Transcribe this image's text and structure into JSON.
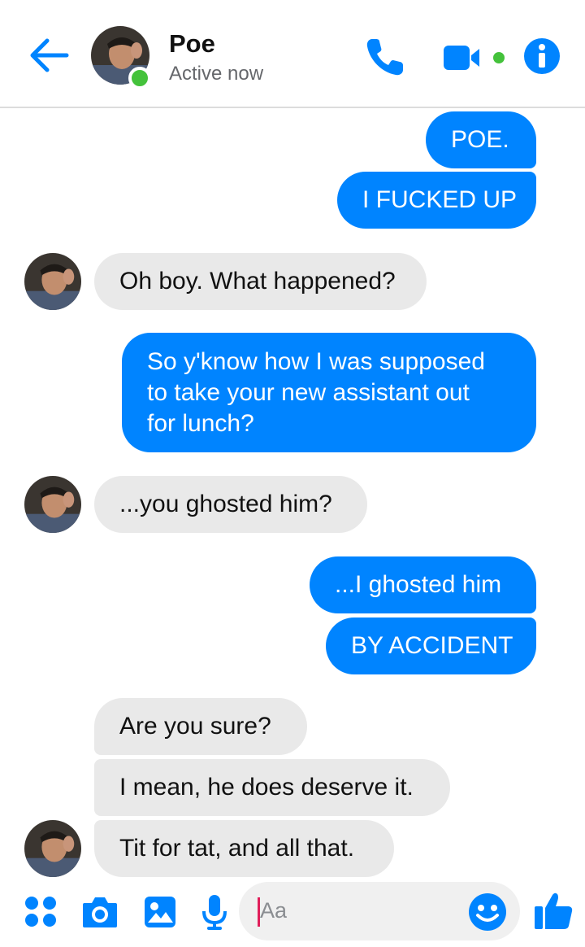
{
  "header": {
    "contact_name": "Poe",
    "status": "Active now",
    "icons": [
      "back-arrow-icon",
      "phone-icon",
      "video-camera-icon",
      "info-icon"
    ],
    "accent_color": "#0084ff",
    "online_color": "#44c23b"
  },
  "messages": [
    {
      "direction": "sent",
      "lines": [
        "POE."
      ]
    },
    {
      "direction": "sent",
      "lines": [
        "I FUCKED UP"
      ]
    },
    {
      "direction": "received",
      "lines": [
        "Oh boy. What happened?"
      ]
    },
    {
      "direction": "sent",
      "lines": [
        "So y'know how I was supposed",
        "to take your new assistant out",
        "for lunch?"
      ]
    },
    {
      "direction": "received",
      "lines": [
        "...you ghosted him?"
      ]
    },
    {
      "direction": "sent",
      "lines": [
        "...I ghosted him"
      ]
    },
    {
      "direction": "sent",
      "lines": [
        "BY ACCIDENT"
      ]
    },
    {
      "direction": "received",
      "lines": [
        "Are you sure?"
      ]
    },
    {
      "direction": "received",
      "lines": [
        "I mean, he does deserve it."
      ]
    },
    {
      "direction": "received",
      "lines": [
        "Tit for tat, and all that."
      ]
    }
  ],
  "composer": {
    "placeholder": "Aa",
    "icons": [
      "apps-grid-icon",
      "camera-icon",
      "image-icon",
      "microphone-icon",
      "emoji-icon",
      "thumbs-up-icon"
    ]
  },
  "colors": {
    "sent_bubble": "#0084ff",
    "received_bubble": "#e9e9e9"
  }
}
